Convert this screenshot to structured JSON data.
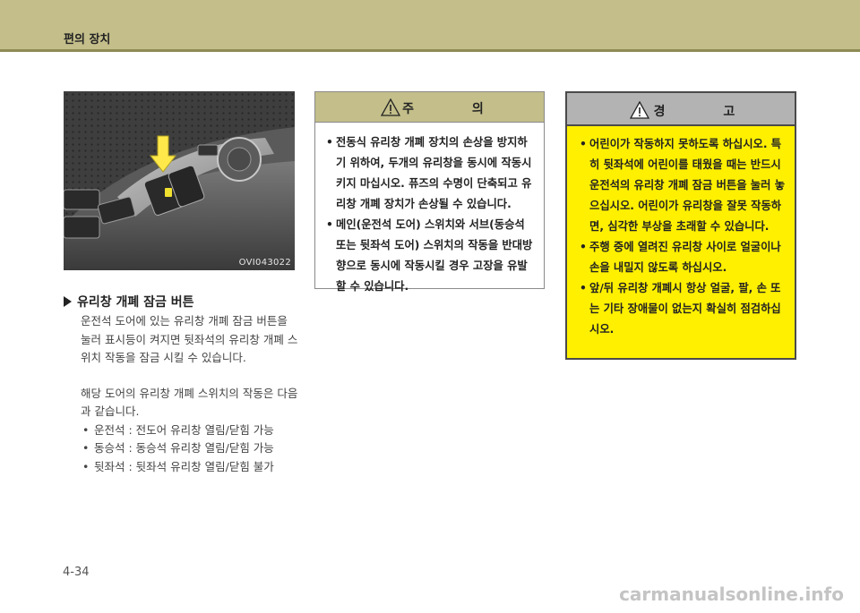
{
  "header": {
    "title": "편의 장치"
  },
  "photo": {
    "code": "OVI043022"
  },
  "section": {
    "title": "유리창 개폐 잠금 버튼",
    "paragraph1": "운전석 도어에 있는 유리창 개폐 잠금 버튼을 눌러 표시등이 켜지면 뒷좌석의 유리창 개폐 스위치 작동을 잠금 시킬 수 있습니다.",
    "paragraph2": "해당 도어의 유리창 개폐 스위치의 작동은 다음과 같습니다.",
    "bullets": [
      "운전석 : 전도어 유리창 열림/닫힘 가능",
      "동승석 : 동승석 유리창 열림/닫힘 가능",
      "뒷좌석 : 뒷좌석 유리창 열림/닫힘 불가"
    ]
  },
  "caution": {
    "title": "주 의",
    "items": [
      "전동식 유리창 개폐 장치의 손상을 방지하기 위하여, 두개의 유리창을 동시에 작동시키지 마십시오. 퓨즈의 수명이 단축되고 유리창 개폐 장치가 손상될 수 있습니다.",
      "메인(운전석 도어) 스위치와 서브(동승석 또는 뒷좌석 도어) 스위치의 작동을 반대방향으로 동시에 작동시킬 경우 고장을 유발할 수 있습니다."
    ]
  },
  "warning": {
    "title": "경 고",
    "items": [
      "어린이가 작동하지 못하도록 하십시오. 특히 뒷좌석에 어린이를 태웠을 때는 반드시 운전석의 유리창 개폐 잠금 버튼을 눌러 놓으십시오. 어린이가 유리창을 잘못 작동하면, 심각한 부상을 초래할 수 있습니다.",
      "주행 중에 열려진 유리창 사이로 얼굴이나 손을 내밀지 않도록 하십시오.",
      "앞/뒤 유리창 개폐시 항상 얼굴, 팔, 손 또는 기타 장애물이 없는지 확실히 점검하십시오."
    ]
  },
  "icons": {
    "warning": "warning-triangle-icon",
    "section_marker": "triangle-right-icon"
  },
  "colors": {
    "header_band": "#c3be8a",
    "warning_bg": "#fff000",
    "warning_head": "#b3b3b3"
  },
  "page": {
    "number": "4-34"
  },
  "watermark": "carmanualsonline.info"
}
